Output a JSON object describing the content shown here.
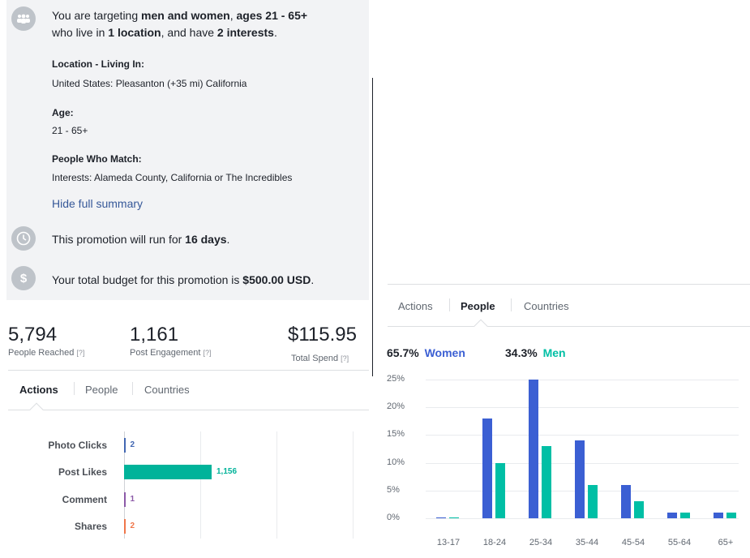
{
  "summary": {
    "audience_pre": "You are targeting ",
    "audience_gender": "men and women",
    "audience_mid": ", ",
    "audience_ages": "ages 21 - 65+",
    "audience_line2_pre": "who live in ",
    "audience_locations": "1 location",
    "audience_line2_mid": ", and have ",
    "audience_interests": "2 interests",
    "audience_line2_end": ".",
    "location_label": "Location - Living In:",
    "location_value": "United States: Pleasanton (+35 mi) California",
    "age_label": "Age:",
    "age_value": "21 - 65+",
    "match_label": "People Who Match:",
    "match_value": "Interests: Alameda County, California or The Incredibles",
    "hide_link": "Hide full summary",
    "duration_pre": "This promotion will run for ",
    "duration_value": "16 days",
    "duration_end": ".",
    "budget_pre": "Your total budget for this promotion is ",
    "budget_value": "$500.00 USD",
    "budget_end": "."
  },
  "stats": {
    "reached_value": "5,794",
    "reached_label": "People Reached",
    "engagement_value": "1,161",
    "engagement_label": "Post Engagement",
    "spend_value": "$115.95",
    "spend_label": "Total Spend",
    "help_mark": "[?]"
  },
  "tabs": [
    "Actions",
    "People",
    "Countries"
  ],
  "actions_chart": {
    "type": "bar",
    "max": 1156,
    "rows": [
      {
        "label": "Photo Clicks",
        "value": 2,
        "display": "2",
        "color": "#4267b2"
      },
      {
        "label": "Post Likes",
        "value": 1156,
        "display": "1,156",
        "color": "#00b39a"
      },
      {
        "label": "Comment",
        "value": 1,
        "display": "1",
        "color": "#8c5aa8"
      },
      {
        "label": "Shares",
        "value": 2,
        "display": "2",
        "color": "#f0764a"
      }
    ]
  },
  "people_tabs": [
    "Actions",
    "People",
    "Countries"
  ],
  "chart_data": {
    "type": "bar",
    "categories": [
      "13-17",
      "18-24",
      "25-34",
      "35-44",
      "45-54",
      "55-64",
      "65+"
    ],
    "series": [
      {
        "name": "Women",
        "values": [
          0.2,
          18,
          25,
          14,
          6,
          1,
          1
        ],
        "color": "#3b5fd3"
      },
      {
        "name": "Men",
        "values": [
          0.2,
          10,
          13,
          6,
          3,
          1,
          1
        ],
        "color": "#00bfa5"
      }
    ],
    "ylim": [
      0,
      25
    ],
    "yticks": [
      "0%",
      "5%",
      "10%",
      "15%",
      "20%",
      "25%"
    ],
    "women_pct": "65.7%",
    "women_label": "Women",
    "men_pct": "34.3%",
    "men_label": "Men"
  }
}
